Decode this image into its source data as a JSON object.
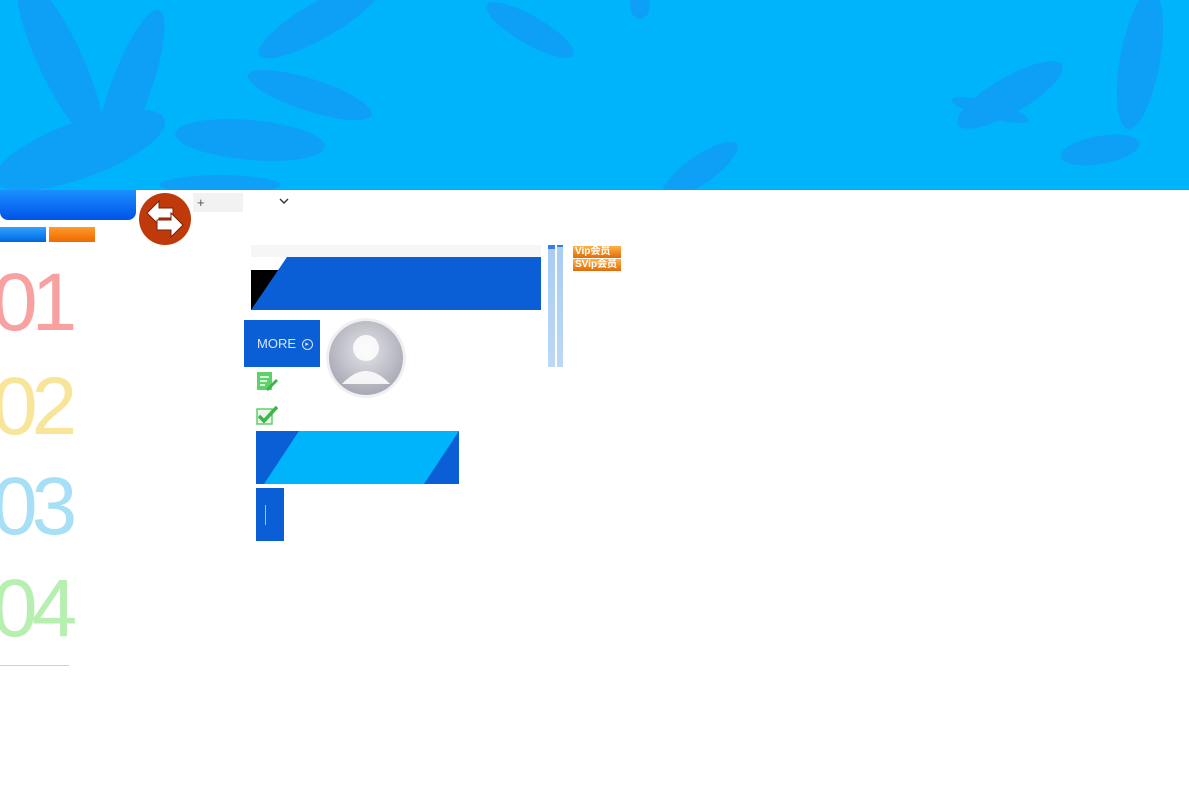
{
  "banner": {
    "color": "#00b4fc",
    "petal_color": "#1a8ff2"
  },
  "toolbar": {
    "plus_label": "+",
    "swap_icon": "swap-arrows-icon",
    "dropdown_icon": "chevron-down-icon"
  },
  "steps": [
    "01",
    "02",
    "03",
    "04"
  ],
  "panel": {
    "more_label": "MORE",
    "more_arrow": "▸"
  },
  "badges": {
    "vip1": "Vip会员",
    "vip2": "SVip会员"
  },
  "colors": {
    "primary_blue": "#0a5fd6",
    "light_blue": "#00b4fc",
    "orange": "#f06a00",
    "swap_red": "#c0390b"
  }
}
